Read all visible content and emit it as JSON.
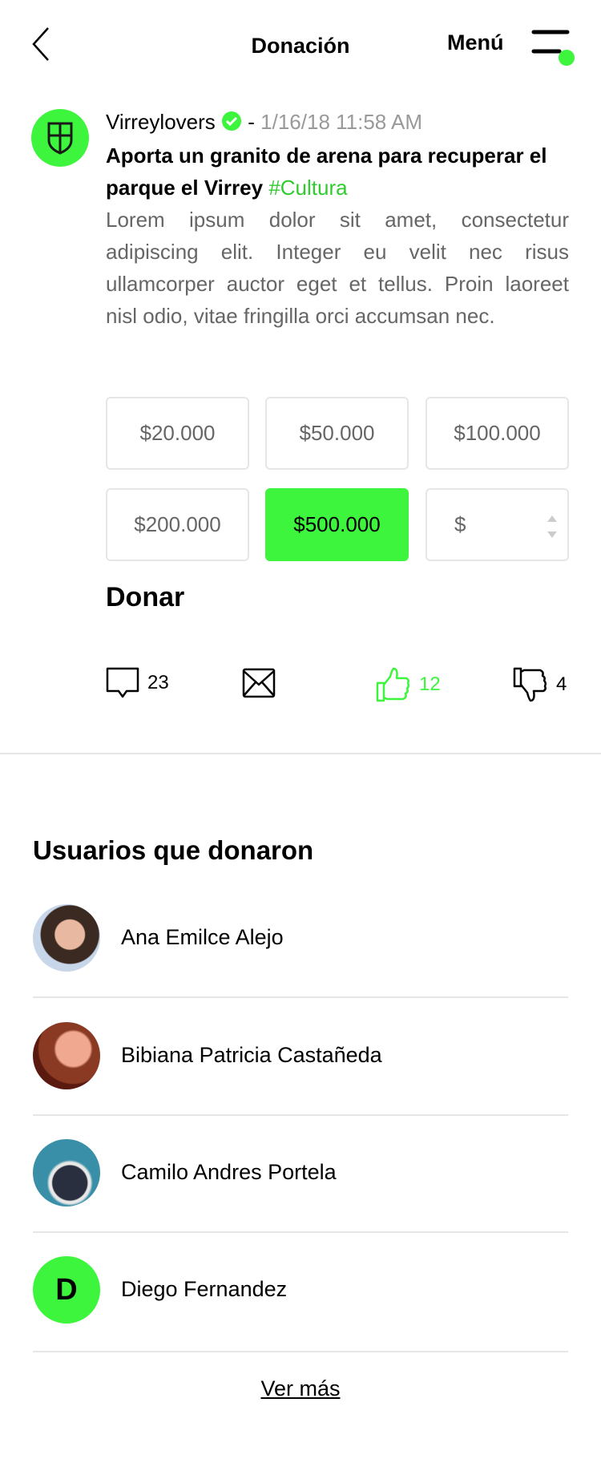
{
  "header": {
    "title": "Donación",
    "menu_label": "Menú"
  },
  "post": {
    "author": "Virreylovers",
    "separator": "-",
    "date": "1/16/18 11:58 AM",
    "title": "Aporta un granito de arena para recuperar el parque el Virrey",
    "hashtag": "#Cultura",
    "body": "Lorem ipsum dolor sit amet, consectetur adipiscing elit. Integer eu velit nec risus ullamcorper auctor eget et tellus. Proin laoreet nisl odio, vitae fringilla orci accumsan nec."
  },
  "amounts": [
    "$20.000",
    "$50.000",
    "$100.000",
    "$200.000",
    "$500.000"
  ],
  "selected_amount": "$500.000",
  "custom_amount": {
    "prefix": "$",
    "value": ""
  },
  "donate_label": "Donar",
  "actions": {
    "comments": "23",
    "likes": "12",
    "dislikes": "4"
  },
  "donors": {
    "title": "Usuarios que donaron",
    "users": [
      {
        "name": "Ana Emilce Alejo"
      },
      {
        "name": "Bibiana Patricia Castañeda"
      },
      {
        "name": "Camilo Andres Portela"
      },
      {
        "name": "Diego Fernandez",
        "initial": "D"
      }
    ],
    "more_label": "Ver más"
  },
  "colors": {
    "accent": "#3df53d",
    "hashtag": "#2fcb2f",
    "muted": "#999999"
  }
}
